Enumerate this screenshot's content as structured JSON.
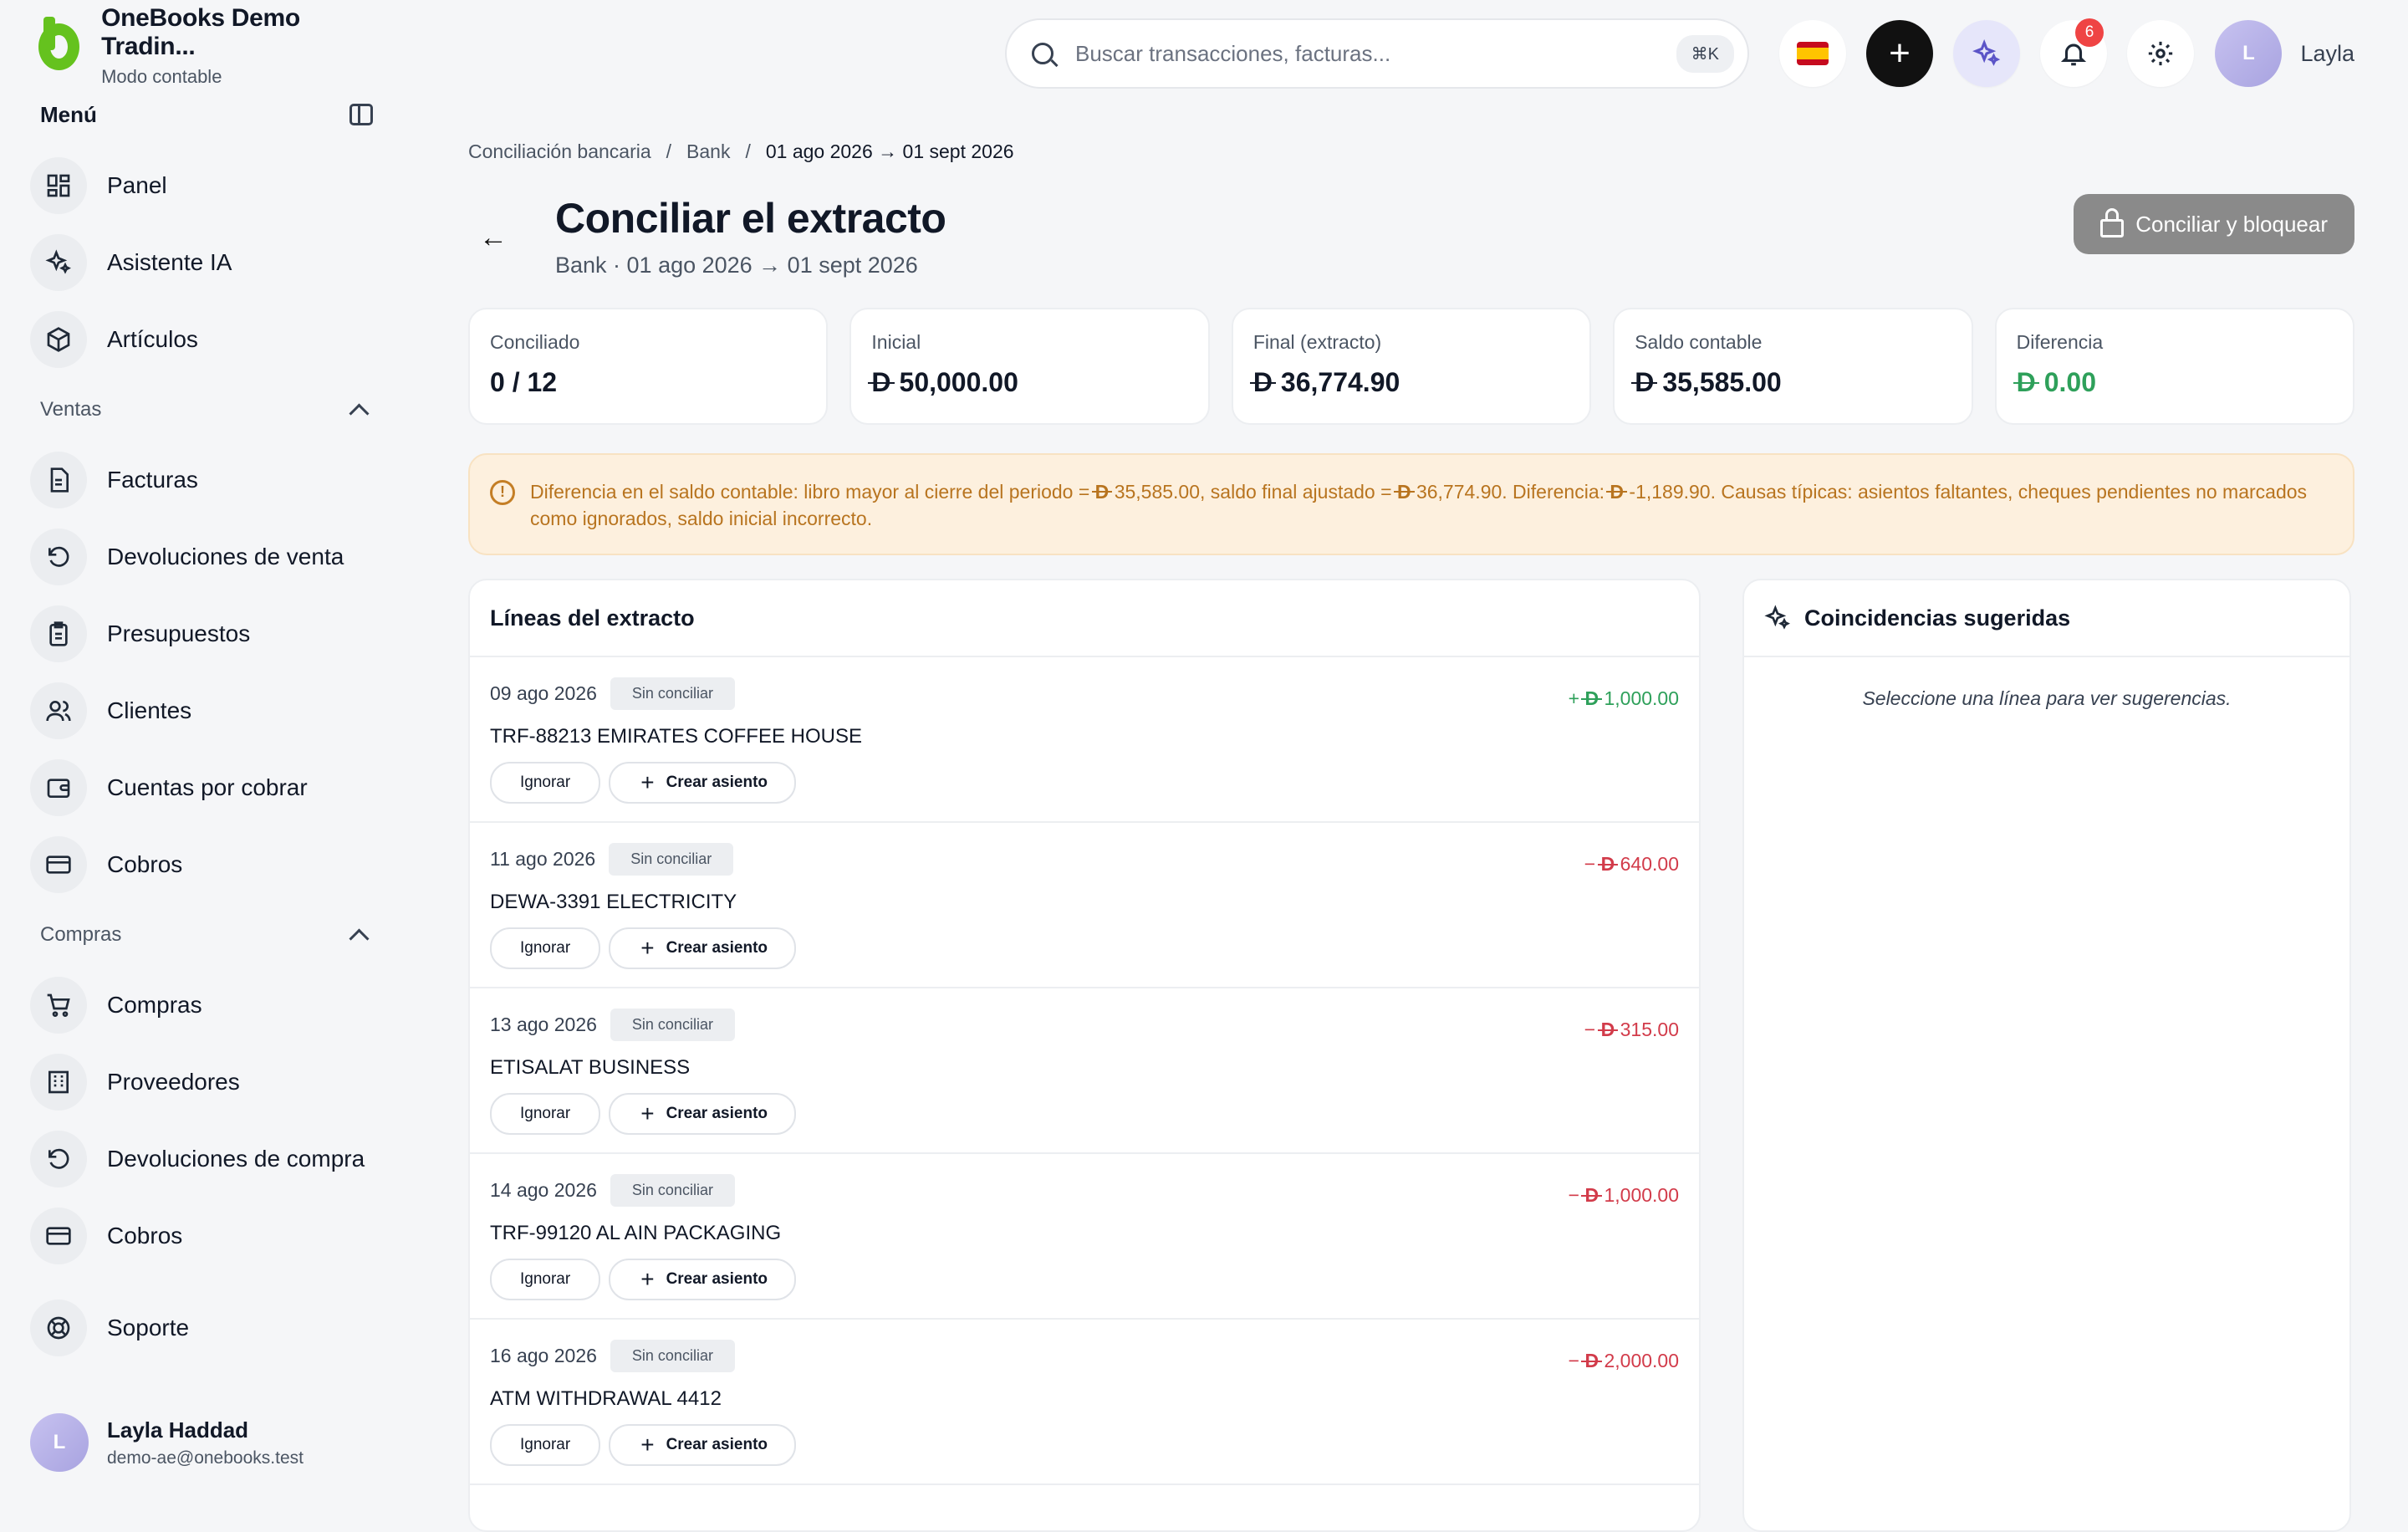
{
  "brand": {
    "name": "OneBooks Demo Tradin...",
    "mode": "Modo contable"
  },
  "menu": {
    "title": "Menú"
  },
  "nav_top": [
    {
      "label": "Panel",
      "icon": "grid-icon"
    },
    {
      "label": "Asistente IA",
      "icon": "sparkles-icon"
    },
    {
      "label": "Artículos",
      "icon": "box-icon"
    }
  ],
  "sections": {
    "ventas": {
      "label": "Ventas",
      "items": [
        {
          "label": "Facturas"
        },
        {
          "label": "Devoluciones de venta"
        },
        {
          "label": "Presupuestos"
        },
        {
          "label": "Clientes"
        },
        {
          "label": "Cuentas por cobrar"
        },
        {
          "label": "Cobros"
        }
      ]
    },
    "compras": {
      "label": "Compras",
      "items": [
        {
          "label": "Compras"
        },
        {
          "label": "Proveedores"
        },
        {
          "label": "Devoluciones de compra"
        },
        {
          "label": "Cobros"
        }
      ]
    }
  },
  "support": {
    "label": "Soporte"
  },
  "user": {
    "initial": "L",
    "name": "Layla Haddad",
    "email": "demo-ae@onebooks.test",
    "short": "Layla"
  },
  "search": {
    "placeholder": "Buscar transacciones, facturas...",
    "shortcut": "⌘K"
  },
  "notifications": {
    "count": "6"
  },
  "breadcrumb": {
    "a": "Conciliación bancaria",
    "sep": "/",
    "b": "Bank",
    "c": "01 ago 2026 → 01 sept 2026"
  },
  "page": {
    "title": "Conciliar el extracto",
    "subtitle": "Bank · 01 ago 2026 → 01 sept 2026",
    "lock_button": "Conciliar y bloquear"
  },
  "currency_symbol": "D",
  "stats": {
    "conciliado": {
      "label": "Conciliado",
      "value": "0 / 12"
    },
    "inicial": {
      "label": "Inicial",
      "value": "50,000.00"
    },
    "final": {
      "label": "Final (extracto)",
      "value": "36,774.90"
    },
    "saldo": {
      "label": "Saldo contable",
      "value": "35,585.00"
    },
    "diferencia": {
      "label": "Diferencia",
      "value": "0.00"
    }
  },
  "alert": {
    "p1": "Diferencia en el saldo contable: libro mayor al cierre del periodo = ",
    "v1": "35,585.00",
    "p2": ", saldo final ajustado = ",
    "v2": "36,774.90",
    "p3": ". Diferencia: ",
    "v3": "-1,189.90",
    "p4": ". Causas típicas: asientos faltantes, cheques pendientes no marcados como ignorados, saldo inicial incorrecto."
  },
  "lines_panel": {
    "title": "Líneas del extracto"
  },
  "line_labels": {
    "status": "Sin conciliar",
    "ignore": "Ignorar",
    "create": "Crear asiento"
  },
  "lines": [
    {
      "date": "09 ago 2026",
      "desc": "TRF-88213 EMIRATES COFFEE HOUSE",
      "sign": "+",
      "amount": "1,000.00"
    },
    {
      "date": "11 ago 2026",
      "desc": "DEWA-3391 ELECTRICITY",
      "sign": "−",
      "amount": "640.00"
    },
    {
      "date": "13 ago 2026",
      "desc": "ETISALAT BUSINESS",
      "sign": "−",
      "amount": "315.00"
    },
    {
      "date": "14 ago 2026",
      "desc": "TRF-99120 AL AIN PACKAGING",
      "sign": "−",
      "amount": "1,000.00"
    },
    {
      "date": "16 ago 2026",
      "desc": "ATM WITHDRAWAL 4412",
      "sign": "−",
      "amount": "2,000.00"
    }
  ],
  "suggest_panel": {
    "title": "Coincidencias sugeridas",
    "empty": "Seleccione una línea para ver sugerencias."
  },
  "colors": {
    "brand": "#65c21e",
    "positive": "#2ea05a",
    "negative": "#d23b4a",
    "warning": "#b8741f"
  }
}
